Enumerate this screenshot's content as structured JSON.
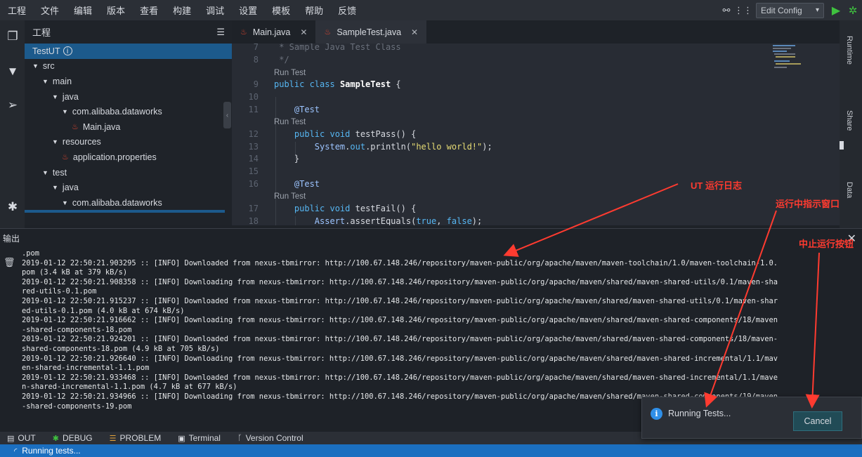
{
  "menubar": {
    "items": [
      "工程",
      "文件",
      "编辑",
      "版本",
      "查看",
      "构建",
      "调试",
      "设置",
      "模板",
      "帮助",
      "反馈"
    ],
    "run_config": "Edit Config"
  },
  "project": {
    "title": "工程",
    "root": "TestUT",
    "tree": [
      {
        "label": "src",
        "depth": 0,
        "kind": "folder"
      },
      {
        "label": "main",
        "depth": 1,
        "kind": "folder"
      },
      {
        "label": "java",
        "depth": 2,
        "kind": "folder"
      },
      {
        "label": "com.alibaba.dataworks",
        "depth": 3,
        "kind": "folder"
      },
      {
        "label": "Main.java",
        "depth": 4,
        "kind": "file"
      },
      {
        "label": "resources",
        "depth": 2,
        "kind": "folder"
      },
      {
        "label": "application.properties",
        "depth": 3,
        "kind": "file"
      },
      {
        "label": "test",
        "depth": 1,
        "kind": "folder"
      },
      {
        "label": "java",
        "depth": 2,
        "kind": "folder"
      },
      {
        "label": "com.alibaba.dataworks",
        "depth": 3,
        "kind": "folder"
      }
    ]
  },
  "tabs": [
    {
      "label": "Main.java",
      "active": false
    },
    {
      "label": "SampleTest.java",
      "active": true
    }
  ],
  "editor": {
    "lines": [
      {
        "n": "7",
        "text": " * Sample Java Test Class",
        "style": "cmt"
      },
      {
        "n": "8",
        "text": " */",
        "style": "cmt"
      },
      {
        "lens": "Run Test"
      },
      {
        "n": "9",
        "text": "public class SampleTest {",
        "style": "class"
      },
      {
        "n": "10",
        "text": ""
      },
      {
        "n": "11",
        "text": "    @Test",
        "style": "ann"
      },
      {
        "lens": "Run Test"
      },
      {
        "n": "12",
        "text": "    public void testPass() {",
        "style": "method"
      },
      {
        "n": "13",
        "text": "        System.out.println(\"hello world!\");",
        "style": "print"
      },
      {
        "n": "14",
        "text": "    }"
      },
      {
        "n": "15",
        "text": ""
      },
      {
        "n": "16",
        "text": "    @Test",
        "style": "ann"
      },
      {
        "lens": "Run Test"
      },
      {
        "n": "17",
        "text": "    public void testFail() {",
        "style": "method"
      },
      {
        "n": "18",
        "text": "        Assert.assertEquals(true, false);",
        "style": "assert"
      }
    ]
  },
  "right_panel": {
    "items": [
      "Runtime",
      "Share",
      "Data"
    ]
  },
  "output": {
    "title": "输出",
    "log": [
      ".pom",
      "2019-01-12 22:50:21.903295 :: [INFO] Downloaded from nexus-tbmirror: http://100.67.148.246/repository/maven-public/org/apache/maven/maven-toolchain/1.0/maven-toolchain-1.0.",
      "pom (3.4 kB at 379 kB/s)",
      "2019-01-12 22:50:21.908358 :: [INFO] Downloading from nexus-tbmirror: http://100.67.148.246/repository/maven-public/org/apache/maven/shared/maven-shared-utils/0.1/maven-sha",
      "red-utils-0.1.pom",
      "2019-01-12 22:50:21.915237 :: [INFO] Downloaded from nexus-tbmirror: http://100.67.148.246/repository/maven-public/org/apache/maven/shared/maven-shared-utils/0.1/maven-shar",
      "ed-utils-0.1.pom (4.0 kB at 674 kB/s)",
      "2019-01-12 22:50:21.916662 :: [INFO] Downloading from nexus-tbmirror: http://100.67.148.246/repository/maven-public/org/apache/maven/shared/maven-shared-components/18/maven",
      "-shared-components-18.pom",
      "2019-01-12 22:50:21.924201 :: [INFO] Downloaded from nexus-tbmirror: http://100.67.148.246/repository/maven-public/org/apache/maven/shared/maven-shared-components/18/maven-",
      "shared-components-18.pom (4.9 kB at 705 kB/s)",
      "2019-01-12 22:50:21.926640 :: [INFO] Downloading from nexus-tbmirror: http://100.67.148.246/repository/maven-public/org/apache/maven/shared/maven-shared-incremental/1.1/mav",
      "en-shared-incremental-1.1.pom",
      "2019-01-12 22:50:21.933468 :: [INFO] Downloaded from nexus-tbmirror: http://100.67.148.246/repository/maven-public/org/apache/maven/shared/maven-shared-incremental/1.1/mave",
      "n-shared-incremental-1.1.pom (4.7 kB at 677 kB/s)",
      "2019-01-12 22:50:21.934966 :: [INFO] Downloading from nexus-tbmirror: http://100.67.148.246/repository/maven-public/org/apache/maven/shared/maven-shared-components/19/maven",
      "-shared-components-19.pom"
    ]
  },
  "bottom_tabs": [
    {
      "icon": "▤",
      "label": "OUT"
    },
    {
      "icon": "✱",
      "label": "DEBUG"
    },
    {
      "icon": "☰",
      "label": "PROBLEM"
    },
    {
      "icon": "▣",
      "label": "Terminal"
    },
    {
      "icon": "ᚴ",
      "label": "Version Control"
    }
  ],
  "status": {
    "text": "Running tests..."
  },
  "notification": {
    "text": "Running Tests...",
    "button": "Cancel"
  },
  "annotations": {
    "log": "UT 运行日志",
    "window": "运行中指示窗口",
    "stop": "中止运行按钮"
  },
  "colors": {
    "accent": "#1b6fc0",
    "annotation": "#ff3b30",
    "run": "#3fc23f"
  }
}
